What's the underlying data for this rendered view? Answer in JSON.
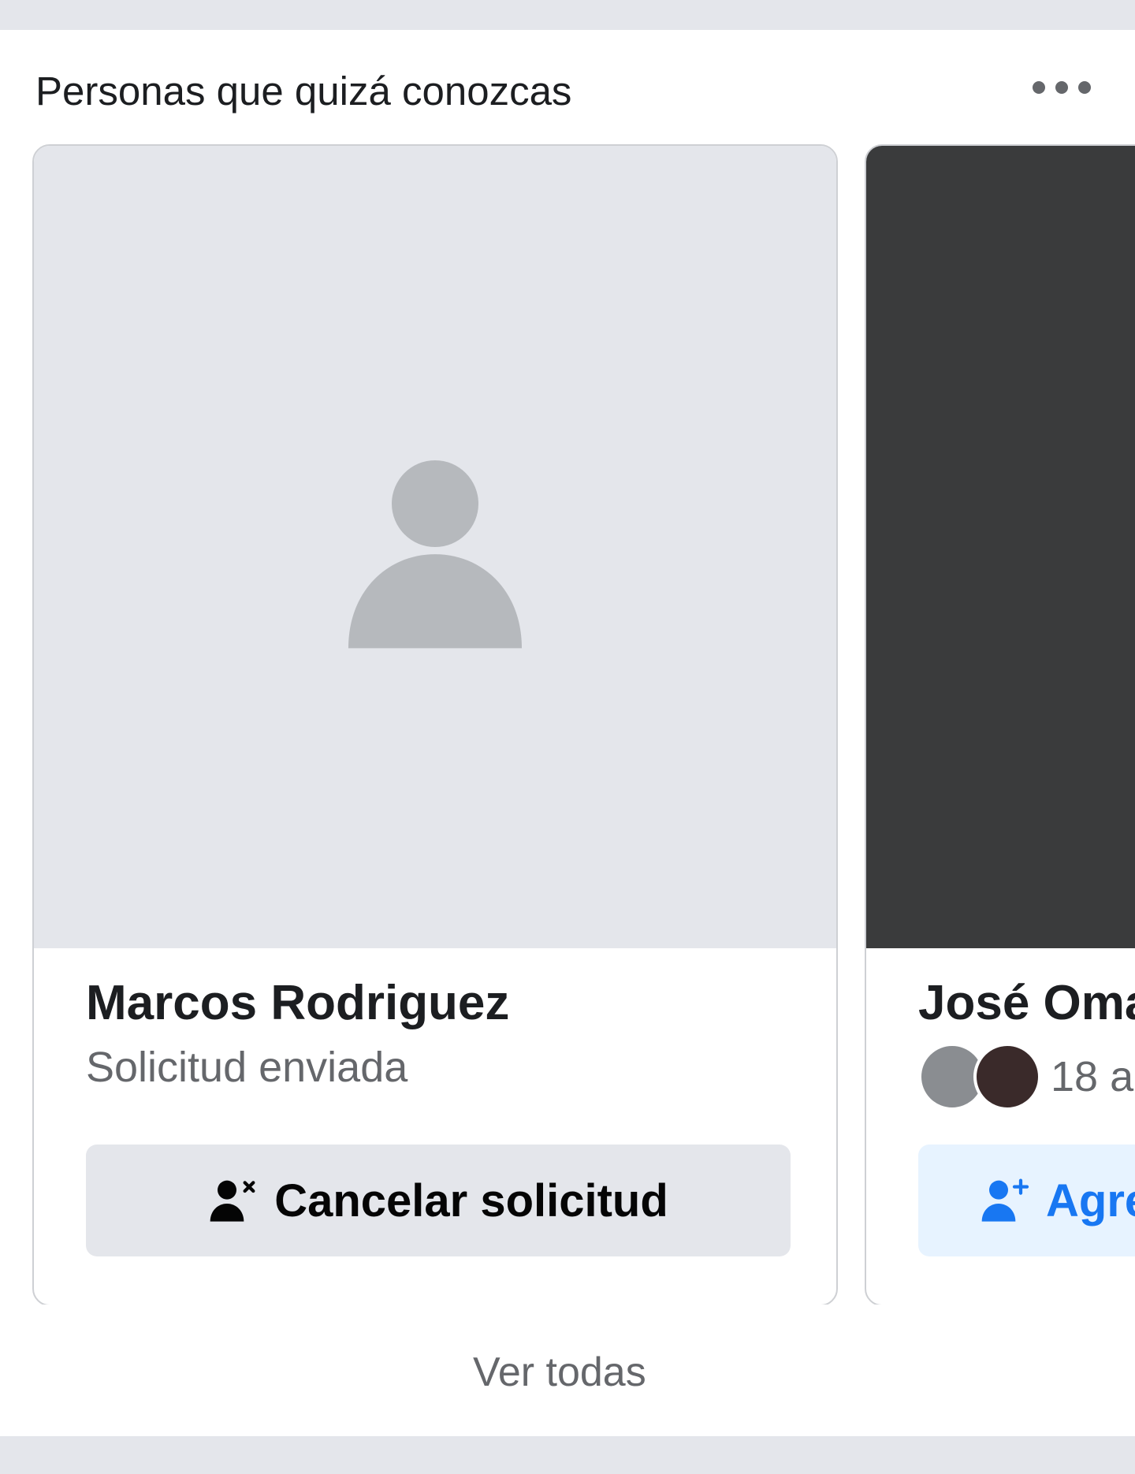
{
  "header": {
    "title": "Personas que quizá conozcas"
  },
  "cards": [
    {
      "name": "Marcos Rodriguez",
      "status": "Solicitud enviada",
      "button_label": "Cancelar solicitud",
      "button_icon": "user-cancel-icon"
    },
    {
      "name": "José Oma",
      "mutual_text": "18 a",
      "button_label": "Agre",
      "button_icon": "user-add-icon"
    }
  ],
  "footer": {
    "see_all_label": "Ver todas"
  },
  "colors": {
    "band": "#e4e6eb",
    "primary_text": "#1c1e21",
    "secondary_text": "#65676b",
    "accent_blue": "#1877f2",
    "add_button_bg": "#e7f3ff",
    "cancel_button_bg": "#e4e6eb"
  }
}
